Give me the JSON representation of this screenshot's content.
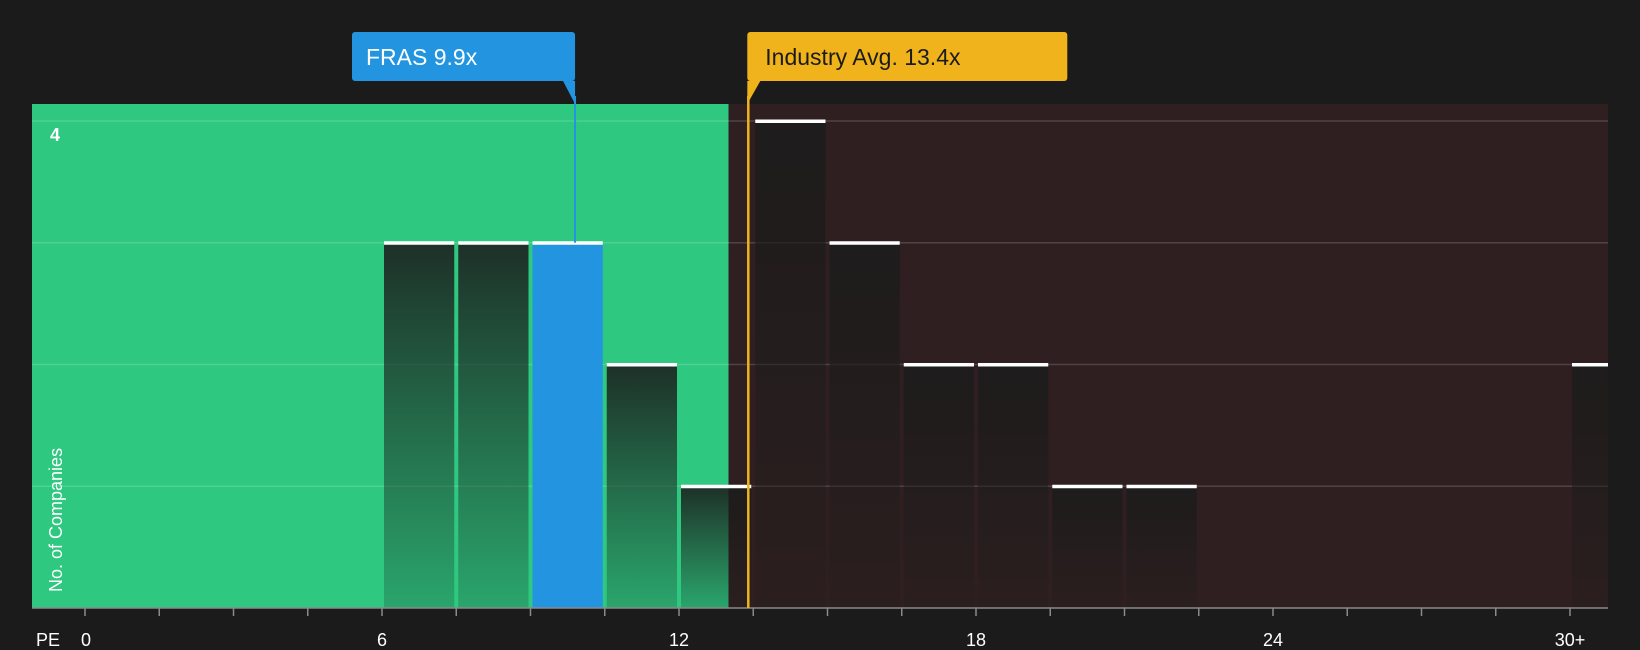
{
  "chart_data": {
    "type": "bar",
    "title": "",
    "xlabel": "PE",
    "ylabel": "No. of Companies",
    "x_ticks": [
      "0",
      "6",
      "12",
      "18",
      "24",
      "30+"
    ],
    "y_ticks": [
      "4"
    ],
    "ylim": [
      0,
      4
    ],
    "xlim": [
      -1,
      31
    ],
    "grid": true,
    "bins": [
      {
        "start": 6,
        "end": 7.5,
        "value": 3
      },
      {
        "start": 7.5,
        "end": 9,
        "value": 3
      },
      {
        "start": 9,
        "end": 10.5,
        "value": 3,
        "highlight": true
      },
      {
        "start": 10.5,
        "end": 12,
        "value": 2
      },
      {
        "start": 12,
        "end": 13.5,
        "value": 1
      },
      {
        "start": 13.5,
        "end": 15,
        "value": 4
      },
      {
        "start": 15,
        "end": 16.5,
        "value": 3
      },
      {
        "start": 16.5,
        "end": 18,
        "value": 2
      },
      {
        "start": 18,
        "end": 19.5,
        "value": 2
      },
      {
        "start": 19.5,
        "end": 21,
        "value": 1
      },
      {
        "start": 21,
        "end": 22.5,
        "value": 1
      },
      {
        "start": 30,
        "end": 31,
        "value": 2
      }
    ],
    "company": {
      "label": "FRAS 9.9x",
      "value": 9.9
    },
    "industry": {
      "label": "Industry Avg. 13.4x",
      "value": 13.4
    },
    "colors": {
      "undervalued_zone": "#2ec880",
      "overvalued_zone": "#2f1f20",
      "company": "#2394e0",
      "industry": "#f0b31c",
      "bar_top": "#ffffff"
    }
  }
}
